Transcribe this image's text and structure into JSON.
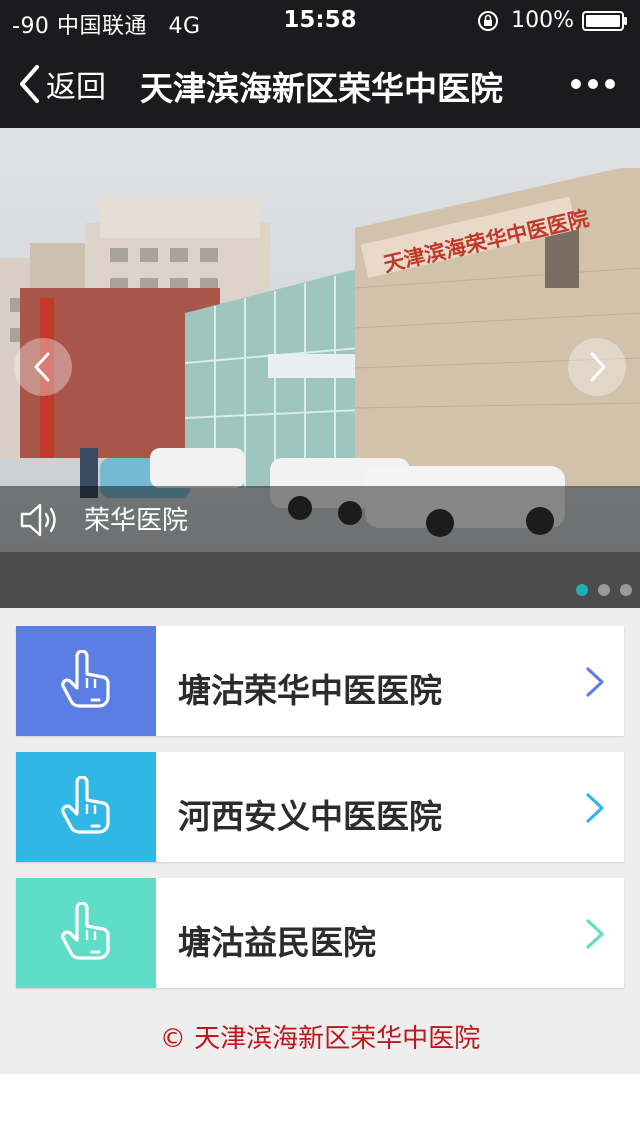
{
  "status_bar": {
    "signal": "-90",
    "carrier": "中国联通",
    "network": "4G",
    "time": "15:58",
    "battery": "100%"
  },
  "nav": {
    "back_label": "返回",
    "title": "天津滨海新区荣华中医院",
    "more_icon": "more-dots-icon"
  },
  "banner": {
    "caption": "荣华医院",
    "slide_count": 3,
    "active_slide": 1,
    "sign_text": "天津滨海荣华中医医院"
  },
  "hospitals": [
    {
      "name": "塘沽荣华中医医院",
      "color": "#5b7ee5"
    },
    {
      "name": "河西安义中医医院",
      "color": "#30b7e6"
    },
    {
      "name": "塘沽益民医院",
      "color": "#5fddc6"
    }
  ],
  "footer": {
    "text": "© 天津滨海新区荣华中医院"
  },
  "colors": {
    "nav_bg": "#1b1b1e",
    "footer_text": "#c0151b",
    "dot_active": "#1ab0b8"
  }
}
